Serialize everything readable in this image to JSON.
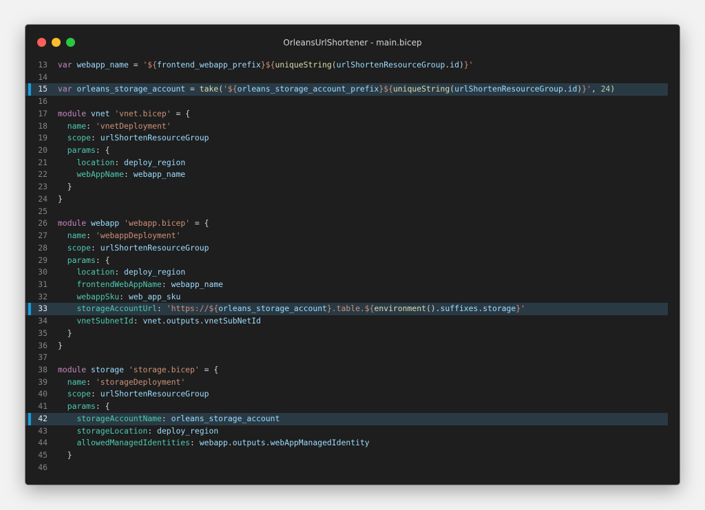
{
  "window": {
    "title": "OrleansUrlShortener - main.bicep",
    "traffic_lights": [
      {
        "name": "close",
        "color": "#ff5f57"
      },
      {
        "name": "minimize",
        "color": "#febc2e"
      },
      {
        "name": "zoom",
        "color": "#28c840"
      }
    ]
  },
  "theme": {
    "highlight_marker_color": "#1a9ed9"
  },
  "editor": {
    "lines": [
      {
        "n": "13",
        "hl": false,
        "tokens": [
          [
            "kw",
            "var"
          ],
          [
            "p",
            " "
          ],
          [
            "var",
            "webapp_name"
          ],
          [
            "p",
            " = "
          ],
          [
            "str",
            "'${"
          ],
          [
            "var",
            "frontend_webapp_prefix"
          ],
          [
            "str",
            "}${"
          ],
          [
            "fn",
            "uniqueString"
          ],
          [
            "p",
            "("
          ],
          [
            "var",
            "urlShortenResourceGroup"
          ],
          [
            "p",
            "."
          ],
          [
            "var",
            "id"
          ],
          [
            "p",
            ")"
          ],
          [
            "str",
            "}'"
          ]
        ]
      },
      {
        "n": "14",
        "hl": false,
        "tokens": []
      },
      {
        "n": "15",
        "hl": true,
        "tokens": [
          [
            "kw",
            "var"
          ],
          [
            "p",
            " "
          ],
          [
            "var",
            "orleans_storage_account"
          ],
          [
            "p",
            " = "
          ],
          [
            "fn",
            "take"
          ],
          [
            "p",
            "("
          ],
          [
            "str",
            "'${"
          ],
          [
            "var",
            "orleans_storage_account_prefix"
          ],
          [
            "str",
            "}${"
          ],
          [
            "fn",
            "uniqueString"
          ],
          [
            "p",
            "("
          ],
          [
            "var",
            "urlShortenResourceGroup"
          ],
          [
            "p",
            "."
          ],
          [
            "var",
            "id"
          ],
          [
            "p",
            ")"
          ],
          [
            "str",
            "}'"
          ],
          [
            "p",
            ", "
          ],
          [
            "num",
            "24"
          ],
          [
            "p",
            ")"
          ]
        ]
      },
      {
        "n": "16",
        "hl": false,
        "tokens": []
      },
      {
        "n": "17",
        "hl": false,
        "tokens": [
          [
            "kw",
            "module"
          ],
          [
            "p",
            " "
          ],
          [
            "var",
            "vnet"
          ],
          [
            "p",
            " "
          ],
          [
            "str",
            "'vnet.bicep'"
          ],
          [
            "p",
            " = {"
          ]
        ]
      },
      {
        "n": "18",
        "hl": false,
        "tokens": [
          [
            "p",
            "  "
          ],
          [
            "prop",
            "name"
          ],
          [
            "p",
            ": "
          ],
          [
            "str",
            "'vnetDeployment'"
          ]
        ]
      },
      {
        "n": "19",
        "hl": false,
        "tokens": [
          [
            "p",
            "  "
          ],
          [
            "prop",
            "scope"
          ],
          [
            "p",
            ": "
          ],
          [
            "var",
            "urlShortenResourceGroup"
          ]
        ]
      },
      {
        "n": "20",
        "hl": false,
        "tokens": [
          [
            "p",
            "  "
          ],
          [
            "prop",
            "params"
          ],
          [
            "p",
            ": {"
          ]
        ]
      },
      {
        "n": "21",
        "hl": false,
        "tokens": [
          [
            "p",
            "    "
          ],
          [
            "prop",
            "location"
          ],
          [
            "p",
            ": "
          ],
          [
            "var",
            "deploy_region"
          ]
        ]
      },
      {
        "n": "22",
        "hl": false,
        "tokens": [
          [
            "p",
            "    "
          ],
          [
            "prop",
            "webAppName"
          ],
          [
            "p",
            ": "
          ],
          [
            "var",
            "webapp_name"
          ]
        ]
      },
      {
        "n": "23",
        "hl": false,
        "tokens": [
          [
            "p",
            "  }"
          ]
        ]
      },
      {
        "n": "24",
        "hl": false,
        "tokens": [
          [
            "p",
            "}"
          ]
        ]
      },
      {
        "n": "25",
        "hl": false,
        "tokens": []
      },
      {
        "n": "26",
        "hl": false,
        "tokens": [
          [
            "kw",
            "module"
          ],
          [
            "p",
            " "
          ],
          [
            "var",
            "webapp"
          ],
          [
            "p",
            " "
          ],
          [
            "str",
            "'webapp.bicep'"
          ],
          [
            "p",
            " = {"
          ]
        ]
      },
      {
        "n": "27",
        "hl": false,
        "tokens": [
          [
            "p",
            "  "
          ],
          [
            "prop",
            "name"
          ],
          [
            "p",
            ": "
          ],
          [
            "str",
            "'webappDeployment'"
          ]
        ]
      },
      {
        "n": "28",
        "hl": false,
        "tokens": [
          [
            "p",
            "  "
          ],
          [
            "prop",
            "scope"
          ],
          [
            "p",
            ": "
          ],
          [
            "var",
            "urlShortenResourceGroup"
          ]
        ]
      },
      {
        "n": "29",
        "hl": false,
        "tokens": [
          [
            "p",
            "  "
          ],
          [
            "prop",
            "params"
          ],
          [
            "p",
            ": {"
          ]
        ]
      },
      {
        "n": "30",
        "hl": false,
        "tokens": [
          [
            "p",
            "    "
          ],
          [
            "prop",
            "location"
          ],
          [
            "p",
            ": "
          ],
          [
            "var",
            "deploy_region"
          ]
        ]
      },
      {
        "n": "31",
        "hl": false,
        "tokens": [
          [
            "p",
            "    "
          ],
          [
            "prop",
            "frontendWebAppName"
          ],
          [
            "p",
            ": "
          ],
          [
            "var",
            "webapp_name"
          ]
        ]
      },
      {
        "n": "32",
        "hl": false,
        "tokens": [
          [
            "p",
            "    "
          ],
          [
            "prop",
            "webappSku"
          ],
          [
            "p",
            ": "
          ],
          [
            "var",
            "web_app_sku"
          ]
        ]
      },
      {
        "n": "33",
        "hl": true,
        "tokens": [
          [
            "p",
            "    "
          ],
          [
            "prop",
            "storageAccountUrl"
          ],
          [
            "p",
            ": "
          ],
          [
            "str",
            "'https://${"
          ],
          [
            "var",
            "orleans_storage_account"
          ],
          [
            "str",
            "}.table.${"
          ],
          [
            "fn",
            "environment"
          ],
          [
            "p",
            "()."
          ],
          [
            "var",
            "suffixes"
          ],
          [
            "p",
            "."
          ],
          [
            "var",
            "storage"
          ],
          [
            "str",
            "}'"
          ]
        ]
      },
      {
        "n": "34",
        "hl": false,
        "tokens": [
          [
            "p",
            "    "
          ],
          [
            "prop",
            "vnetSubnetId"
          ],
          [
            "p",
            ": "
          ],
          [
            "var",
            "vnet"
          ],
          [
            "p",
            "."
          ],
          [
            "var",
            "outputs"
          ],
          [
            "p",
            "."
          ],
          [
            "var",
            "vnetSubNetId"
          ]
        ]
      },
      {
        "n": "35",
        "hl": false,
        "tokens": [
          [
            "p",
            "  }"
          ]
        ]
      },
      {
        "n": "36",
        "hl": false,
        "tokens": [
          [
            "p",
            "}"
          ]
        ]
      },
      {
        "n": "37",
        "hl": false,
        "tokens": []
      },
      {
        "n": "38",
        "hl": false,
        "tokens": [
          [
            "kw",
            "module"
          ],
          [
            "p",
            " "
          ],
          [
            "var",
            "storage"
          ],
          [
            "p",
            " "
          ],
          [
            "str",
            "'storage.bicep'"
          ],
          [
            "p",
            " = {"
          ]
        ]
      },
      {
        "n": "39",
        "hl": false,
        "tokens": [
          [
            "p",
            "  "
          ],
          [
            "prop",
            "name"
          ],
          [
            "p",
            ": "
          ],
          [
            "str",
            "'storageDeployment'"
          ]
        ]
      },
      {
        "n": "40",
        "hl": false,
        "tokens": [
          [
            "p",
            "  "
          ],
          [
            "prop",
            "scope"
          ],
          [
            "p",
            ": "
          ],
          [
            "var",
            "urlShortenResourceGroup"
          ]
        ]
      },
      {
        "n": "41",
        "hl": false,
        "tokens": [
          [
            "p",
            "  "
          ],
          [
            "prop",
            "params"
          ],
          [
            "p",
            ": {"
          ]
        ]
      },
      {
        "n": "42",
        "hl": true,
        "tokens": [
          [
            "p",
            "    "
          ],
          [
            "prop",
            "storageAccountName"
          ],
          [
            "p",
            ": "
          ],
          [
            "var",
            "orleans_storage_account"
          ]
        ]
      },
      {
        "n": "43",
        "hl": false,
        "tokens": [
          [
            "p",
            "    "
          ],
          [
            "prop",
            "storageLocation"
          ],
          [
            "p",
            ": "
          ],
          [
            "var",
            "deploy_region"
          ]
        ]
      },
      {
        "n": "44",
        "hl": false,
        "tokens": [
          [
            "p",
            "    "
          ],
          [
            "prop",
            "allowedManagedIdentities"
          ],
          [
            "p",
            ": "
          ],
          [
            "var",
            "webapp"
          ],
          [
            "p",
            "."
          ],
          [
            "var",
            "outputs"
          ],
          [
            "p",
            "."
          ],
          [
            "var",
            "webAppManagedIdentity"
          ]
        ]
      },
      {
        "n": "45",
        "hl": false,
        "tokens": [
          [
            "p",
            "  }"
          ]
        ]
      },
      {
        "n": "46",
        "hl": false,
        "tokens": []
      }
    ]
  }
}
